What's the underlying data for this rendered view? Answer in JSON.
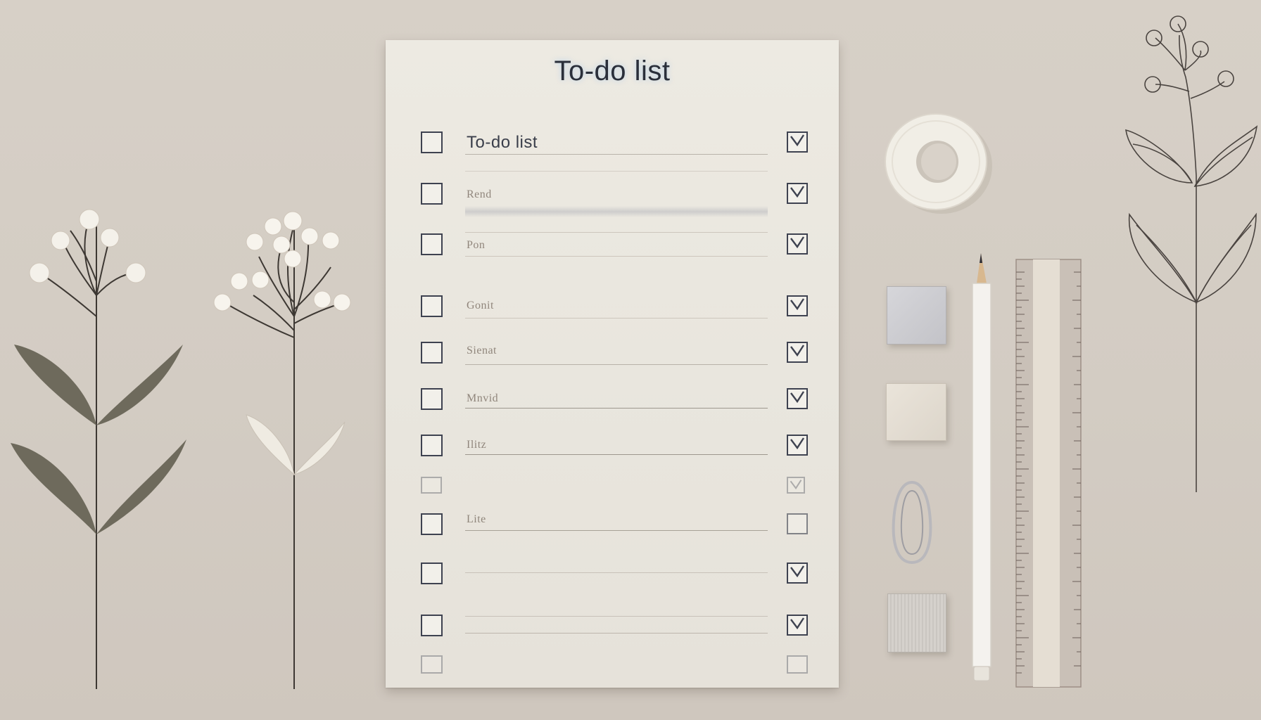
{
  "note": {
    "title": "To-do list",
    "items": [
      {
        "text": "To-do list",
        "done": true
      },
      {
        "text": "Rend",
        "done": true
      },
      {
        "text": "Pon",
        "done": true
      },
      {
        "text": "Gonit",
        "done": true
      },
      {
        "text": "Sienat",
        "done": true
      },
      {
        "text": "Mnvid",
        "done": true
      },
      {
        "text": "Ilitz",
        "done": true
      },
      {
        "text": "",
        "done": true
      },
      {
        "text": "Lite",
        "done": false
      },
      {
        "text": "",
        "done": true
      },
      {
        "text": "",
        "done": true
      },
      {
        "text": "",
        "done": false
      }
    ]
  },
  "icons": {
    "tape": "tape-roll-icon",
    "eraser": "eraser-icon",
    "paperclip": "paperclip-icon",
    "pencil": "pencil-icon",
    "ruler": "ruler-icon",
    "flower": "flower-sprig-icon",
    "plant": "leaf-sprig-icon"
  },
  "colors": {
    "background": "#d5cec5",
    "paper": "#ebe8e0",
    "ink": "#3e4250",
    "leaf": "#6e6a5c",
    "berry": "#f4f1ea"
  }
}
